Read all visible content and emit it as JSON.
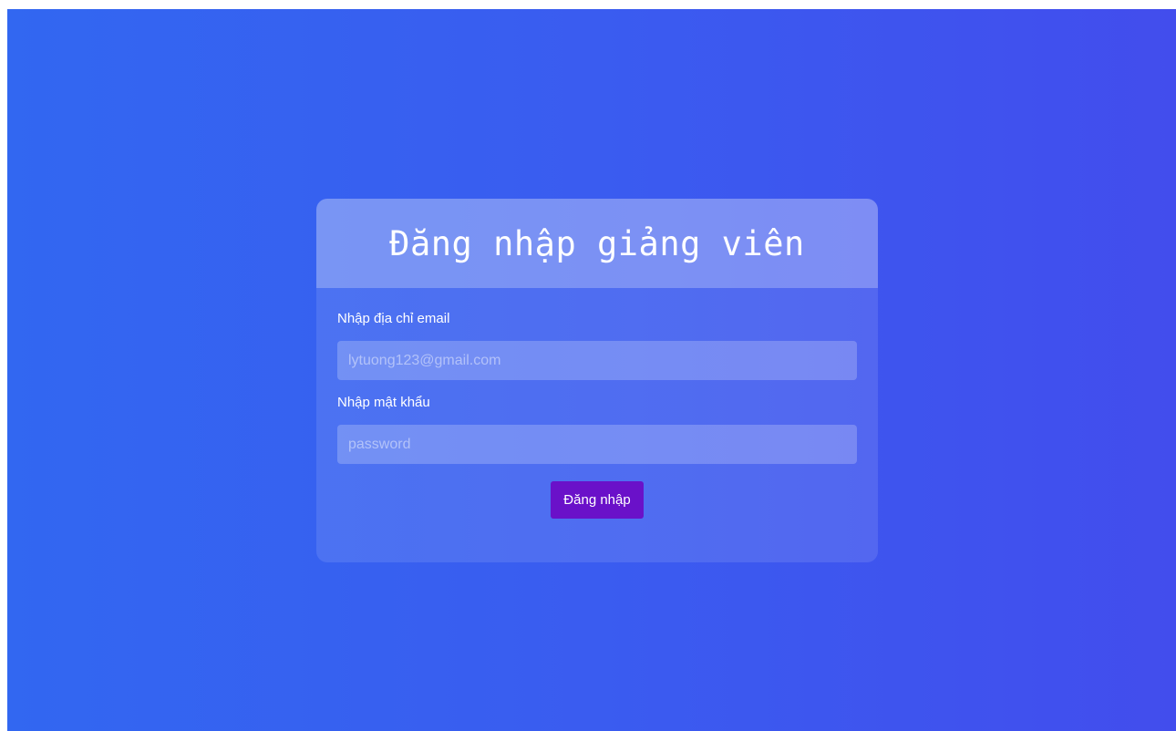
{
  "login": {
    "title": "Đăng nhập giảng viên",
    "email": {
      "label": "Nhập địa chỉ email",
      "placeholder": "lytuong123@gmail.com",
      "value": ""
    },
    "password": {
      "label": "Nhập mật khẩu",
      "placeholder": "password",
      "value": ""
    },
    "submit_label": "Đăng nhập"
  },
  "colors": {
    "background_gradient_start": "#3267f1",
    "background_gradient_end": "#424ded",
    "button": "#6a11c9",
    "text": "#ffffff"
  }
}
